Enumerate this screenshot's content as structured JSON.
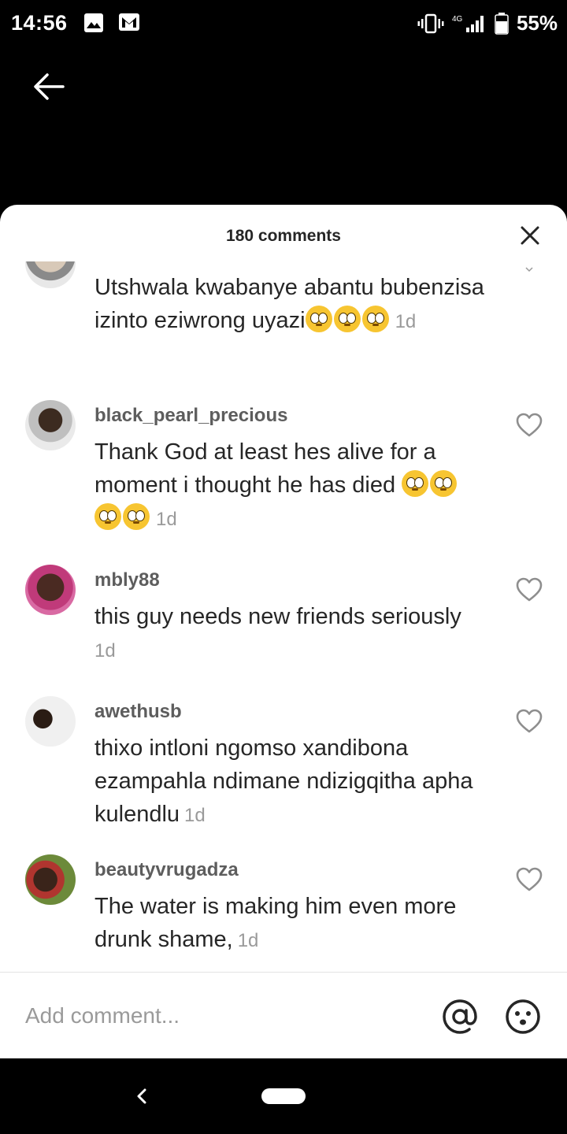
{
  "status_bar": {
    "time": "14:56",
    "network": "4G",
    "battery": "55%"
  },
  "sheet": {
    "title": "180 comments"
  },
  "comments": [
    {
      "username": "",
      "text": "Utshwala kwabanye abantu bubenzisa izinto eziwrong uyazi",
      "emoji_count": 3,
      "time": "1d"
    },
    {
      "username": "black_pearl_precious",
      "text": "Thank God at least hes alive for a moment i thought he has died ",
      "emoji_count": 4,
      "time": "1d"
    },
    {
      "username": "mbly88",
      "text": "this guy needs new friends seriously",
      "emoji_count": 0,
      "time": "1d"
    },
    {
      "username": "awethusb",
      "text": "thixo intloni ngomso xandibona ezampahla ndimane ndizigqitha apha kulendlu",
      "emoji_count": 0,
      "time": "1d"
    },
    {
      "username": "beautyvrugadza",
      "text": "The water is making him even more drunk shame,",
      "emoji_count": 0,
      "time": "1d"
    }
  ],
  "input": {
    "placeholder": "Add comment..."
  },
  "icons": {
    "back": "arrow-left-icon",
    "close": "close-icon",
    "like": "heart-outline-icon",
    "mention": "at-sign-icon",
    "emoji": "smiley-icon"
  },
  "colors": {
    "text": "#262626",
    "muted": "#9a9a9a",
    "username": "#5d5d5d",
    "emoji": "#f7c531"
  }
}
